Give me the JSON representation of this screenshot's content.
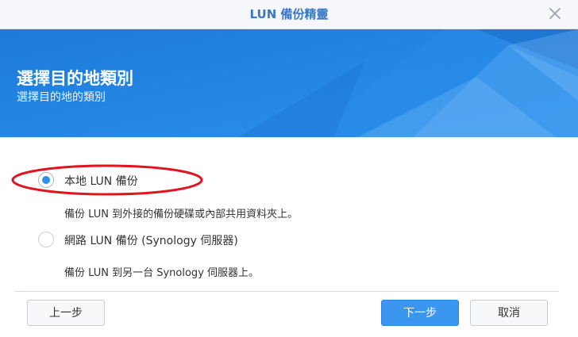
{
  "window": {
    "title": "LUN 備份精靈"
  },
  "banner": {
    "heading": "選擇目的地類別",
    "subheading": "選擇目的地的類別"
  },
  "options": [
    {
      "label": "本地 LUN 備份",
      "description": "備份 LUN 到外接的備份硬碟或內部共用資料夾上。",
      "selected": true
    },
    {
      "label": "網路 LUN 備份 (Synology 伺服器)",
      "description": "備份 LUN 到另一台 Synology 伺服器上。",
      "selected": false
    }
  ],
  "buttons": {
    "back": "上一步",
    "next": "下一步",
    "cancel": "取消"
  },
  "colors": {
    "accent": "#3b96ef",
    "banner": "#1f7fdd",
    "annotation": "#e0141e"
  }
}
